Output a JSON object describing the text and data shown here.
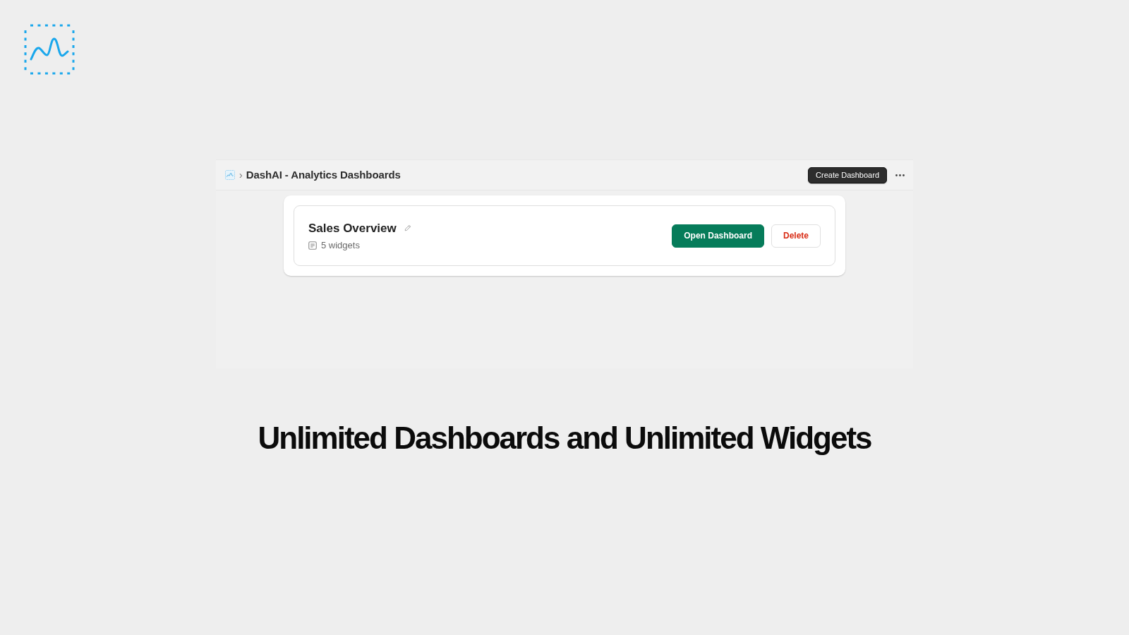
{
  "app_window": {
    "breadcrumb": {
      "separator": "›",
      "title": "DashAI - Analytics Dashboards"
    },
    "create_button": {
      "label": "Create Dashboard"
    },
    "dashboards": [
      {
        "name": "Sales Overview",
        "widgets": "5 widgets",
        "actions": [
          {
            "kind": "primary",
            "label": "Open Dashboard"
          },
          {
            "kind": "danger",
            "label": "Delete"
          }
        ]
      }
    ]
  },
  "headline": "Unlimited Dashboards and Unlimited Widgets"
}
